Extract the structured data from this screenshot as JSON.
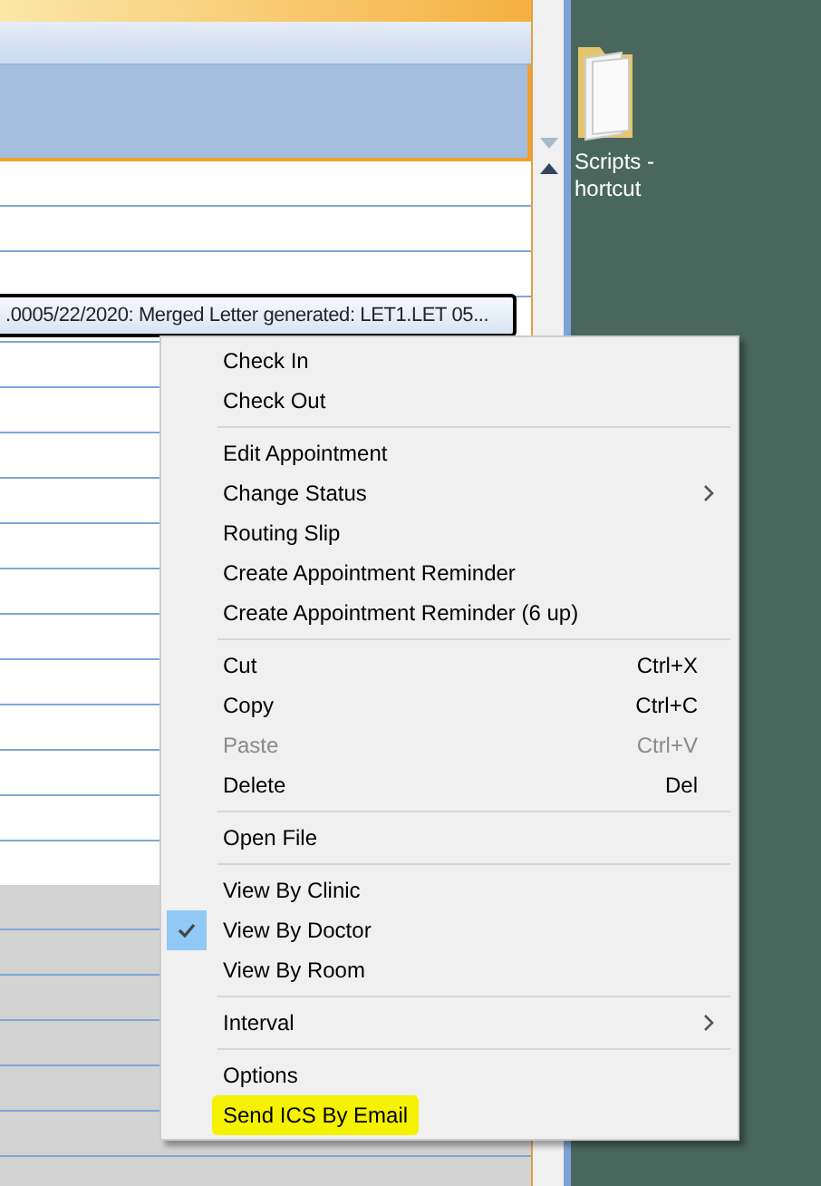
{
  "tooltip": {
    "text": ".0005/22/2020: Merged Letter generated: LET1.LET 05..."
  },
  "context_menu": [
    {
      "kind": "item",
      "label": "Check In",
      "disabled": false,
      "checked": false
    },
    {
      "kind": "item",
      "label": "Check Out",
      "disabled": false,
      "checked": false
    },
    {
      "kind": "separator"
    },
    {
      "kind": "item",
      "label": "Edit Appointment",
      "disabled": false,
      "checked": false
    },
    {
      "kind": "item",
      "label": "Change Status",
      "disabled": false,
      "checked": false,
      "submenu": true
    },
    {
      "kind": "item",
      "label": "Routing Slip",
      "disabled": false,
      "checked": false
    },
    {
      "kind": "item",
      "label": "Create Appointment Reminder",
      "disabled": false,
      "checked": false
    },
    {
      "kind": "item",
      "label": "Create Appointment Reminder (6 up)",
      "disabled": false,
      "checked": false
    },
    {
      "kind": "separator"
    },
    {
      "kind": "item",
      "label": "Cut",
      "shortcut": "Ctrl+X",
      "disabled": false,
      "checked": false
    },
    {
      "kind": "item",
      "label": "Copy",
      "shortcut": "Ctrl+C",
      "disabled": false,
      "checked": false
    },
    {
      "kind": "item",
      "label": "Paste",
      "shortcut": "Ctrl+V",
      "disabled": true,
      "checked": false
    },
    {
      "kind": "item",
      "label": "Delete",
      "shortcut": "Del",
      "disabled": false,
      "checked": false
    },
    {
      "kind": "separator"
    },
    {
      "kind": "item",
      "label": "Open File",
      "disabled": false,
      "checked": false
    },
    {
      "kind": "separator"
    },
    {
      "kind": "item",
      "label": "View By Clinic",
      "disabled": false,
      "checked": false
    },
    {
      "kind": "item",
      "label": "View By Doctor",
      "disabled": false,
      "checked": true
    },
    {
      "kind": "item",
      "label": "View By Room",
      "disabled": false,
      "checked": false
    },
    {
      "kind": "separator"
    },
    {
      "kind": "item",
      "label": "Interval",
      "disabled": false,
      "checked": false,
      "submenu": true
    },
    {
      "kind": "separator"
    },
    {
      "kind": "item",
      "label": "Options",
      "disabled": false,
      "checked": false
    },
    {
      "kind": "item",
      "label": "Send ICS By Email",
      "disabled": false,
      "checked": false,
      "highlighted": true
    }
  ],
  "desktop_icon": {
    "label_lines": [
      "Scripts -",
      "hortcut"
    ]
  }
}
